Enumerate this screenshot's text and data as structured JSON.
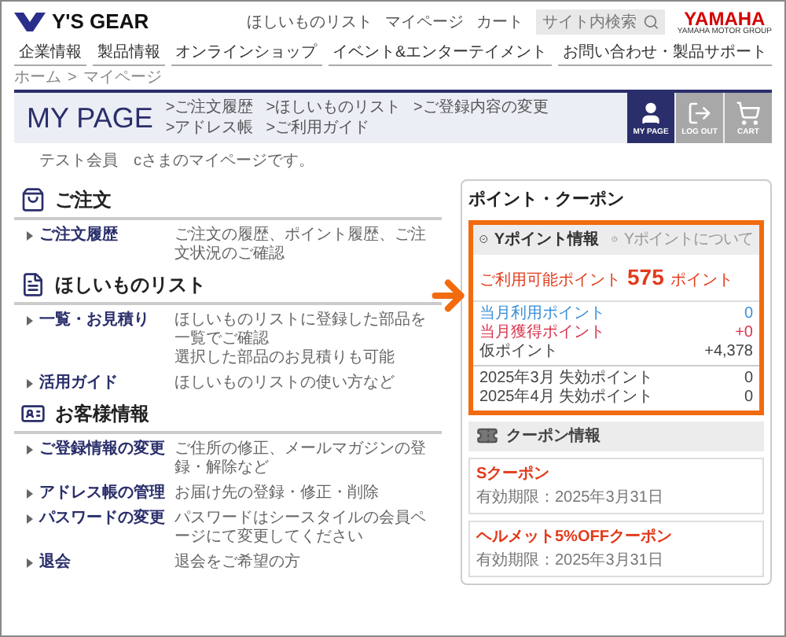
{
  "header": {
    "logo": "Y'S GEAR",
    "links": [
      "ほしいものリスト",
      "マイページ",
      "カート"
    ],
    "search": {
      "placeholder": "サイト内検索"
    },
    "brand": "YAMAHA",
    "brand_sub": "YAMAHA MOTOR GROUP"
  },
  "nav": [
    "企業情報",
    "製品情報",
    "オンラインショップ",
    "イベント&エンターテイメント",
    "お問い合わせ・製品サポート"
  ],
  "breadcrumb": {
    "items": [
      "ホーム",
      "マイページ"
    ],
    "separator": ">"
  },
  "mypage": {
    "title": "MY PAGE",
    "links": [
      ">ご注文履歴",
      ">ほしいものリスト",
      ">ご登録内容の変更",
      ">アドレス帳",
      ">ご利用ガイド"
    ],
    "buttons": [
      {
        "label": "MY PAGE",
        "kind": "user",
        "selected": true
      },
      {
        "label": "LOG OUT",
        "kind": "logout",
        "selected": false
      },
      {
        "label": "CART",
        "kind": "cart",
        "selected": false
      }
    ]
  },
  "greeting": "テスト会員　cさまのマイページです。",
  "sections": [
    {
      "title": "ご注文",
      "kind": "bag",
      "rows": [
        {
          "label": "ご注文履歴",
          "description": [
            "ご注文の履歴、ポイント履歴、ご注文状況のご確認"
          ]
        }
      ]
    },
    {
      "title": "ほしいものリスト",
      "kind": "list",
      "rows": [
        {
          "label": "一覧・お見積り",
          "description": [
            "ほしいものリストに登録した部品を一覧でご確認",
            "選択した部品のお見積りも可能"
          ]
        },
        {
          "label": "活用ガイド",
          "description": [
            "ほしいものリストの使い方など"
          ]
        }
      ]
    },
    {
      "title": "お客様情報",
      "kind": "card",
      "rows": [
        {
          "label": "ご登録情報の変更",
          "description": [
            "ご住所の修正、メールマガジンの登録・解除など"
          ]
        },
        {
          "label": "アドレス帳の管理",
          "description": [
            "お届け先の登録・修正・削除"
          ]
        },
        {
          "label": "パスワードの変更",
          "description": [
            "パスワードはシースタイルの会員ページにて変更してください"
          ]
        },
        {
          "label": "退会",
          "description": [
            "退会をご希望の方"
          ]
        }
      ]
    }
  ],
  "points": {
    "title": "ポイント・クーポン",
    "highlighted": true,
    "ypoint": {
      "title": "Yポイント情報",
      "help": "Yポイントについて",
      "available_label": "ご利用可能ポイント",
      "available_value": "575",
      "available_unit": "ポイント",
      "rows": [
        {
          "label": "当月利用ポイント",
          "value": "0",
          "color": "#3a8fd8"
        },
        {
          "label": "当月獲得ポイント",
          "value": "+0",
          "color": "#d9334c"
        },
        {
          "label": "仮ポイント",
          "value": "+4,378",
          "color": "#444444"
        }
      ],
      "expiry": [
        {
          "label": "2025年3月 失効ポイント",
          "value": "0"
        },
        {
          "label": "2025年4月 失効ポイント",
          "value": "0"
        }
      ]
    },
    "coupons": {
      "title": "クーポン情報",
      "items": [
        {
          "name": "Sクーポン",
          "expiry": "有効期限：2025年3月31日"
        },
        {
          "name": "ヘルメット5%OFFクーポン",
          "expiry": "有効期限：2025年3月31日"
        }
      ]
    }
  }
}
